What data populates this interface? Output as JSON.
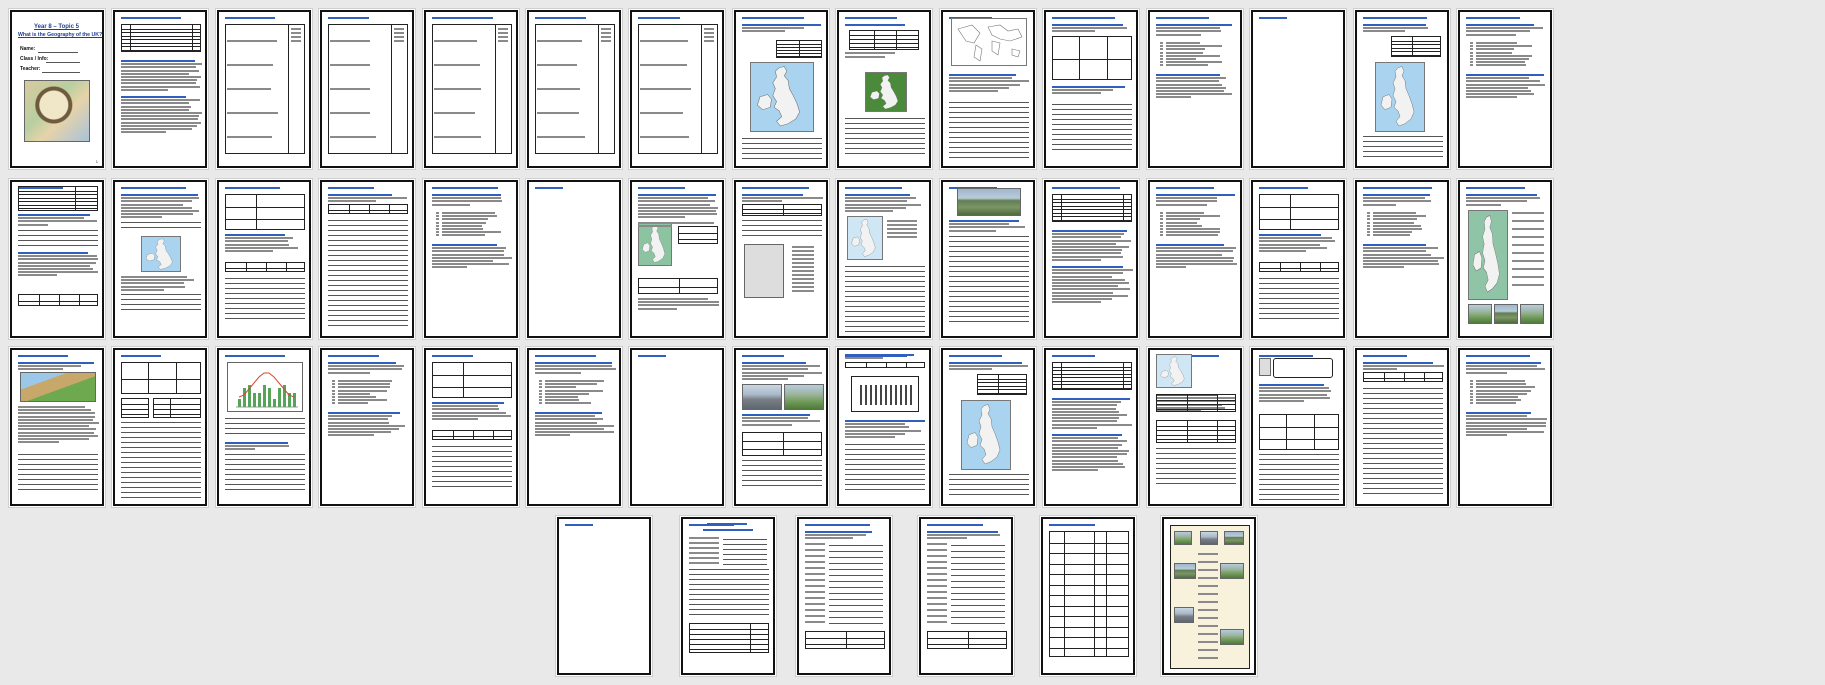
{
  "cover": {
    "line1": "Year 8 – Topic 5",
    "line2": "What is the Geography of the UK?",
    "name_label": "Name:",
    "class_label": "Class / Info:",
    "teacher_label": "Teacher:"
  },
  "page_number_one": "1"
}
